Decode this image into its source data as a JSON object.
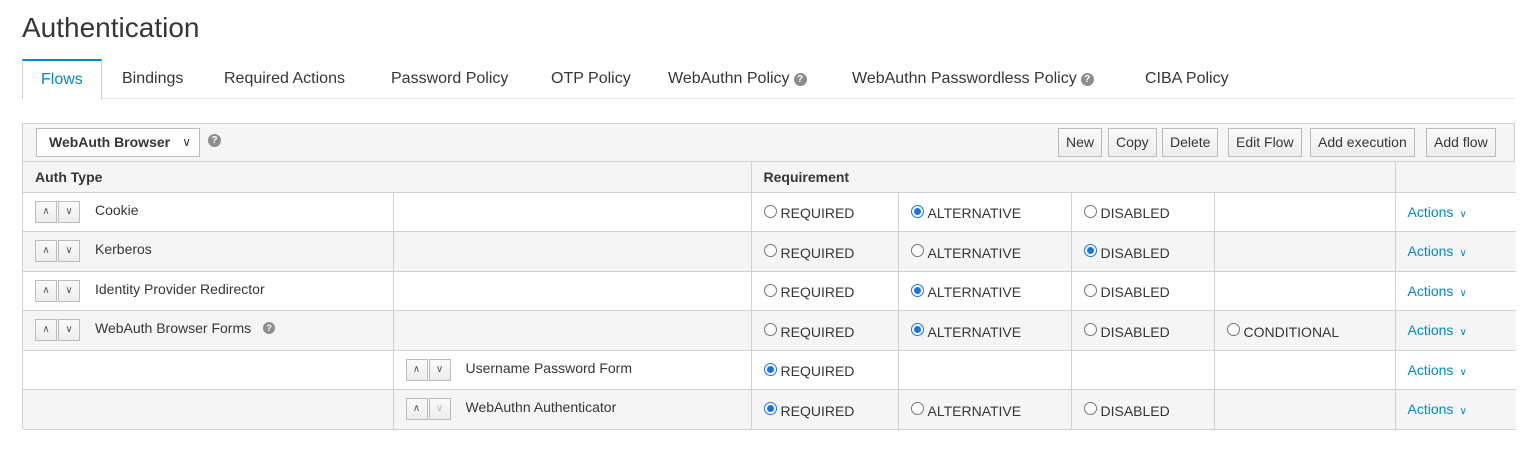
{
  "page": {
    "title": "Authentication"
  },
  "tabs": [
    {
      "label": "Flows",
      "active": true
    },
    {
      "label": "Bindings"
    },
    {
      "label": "Required Actions"
    },
    {
      "label": "Password Policy"
    },
    {
      "label": "OTP Policy"
    },
    {
      "label": "WebAuthn Policy",
      "help": true
    },
    {
      "label": "WebAuthn Passwordless Policy",
      "help": true
    },
    {
      "label": "CIBA Policy"
    }
  ],
  "toolbar": {
    "flow_select": "WebAuth Browser",
    "buttons": {
      "new": "New",
      "copy": "Copy",
      "delete": "Delete",
      "edit_flow": "Edit Flow",
      "add_execution": "Add execution",
      "add_flow": "Add flow"
    }
  },
  "table": {
    "headers": {
      "auth_type": "Auth Type",
      "requirement": "Requirement"
    },
    "options": {
      "required": "REQUIRED",
      "alternative": "ALTERNATIVE",
      "disabled": "DISABLED",
      "conditional": "CONDITIONAL"
    },
    "actions_label": "Actions",
    "rows": [
      {
        "name": "Cookie",
        "level": 0,
        "selected": "alternative"
      },
      {
        "name": "Kerberos",
        "level": 0,
        "selected": "disabled"
      },
      {
        "name": "Identity Provider Redirector",
        "level": 0,
        "selected": "alternative"
      },
      {
        "name": "WebAuth Browser Forms",
        "level": 0,
        "selected": "alternative",
        "help": true
      },
      {
        "name": "Username Password Form",
        "level": 1,
        "selected": "required"
      },
      {
        "name": "WebAuthn Authenticator",
        "level": 1,
        "selected": "required"
      }
    ]
  },
  "colors": {
    "accent": "#0088ce",
    "radio_checked": "#1a73e8"
  }
}
